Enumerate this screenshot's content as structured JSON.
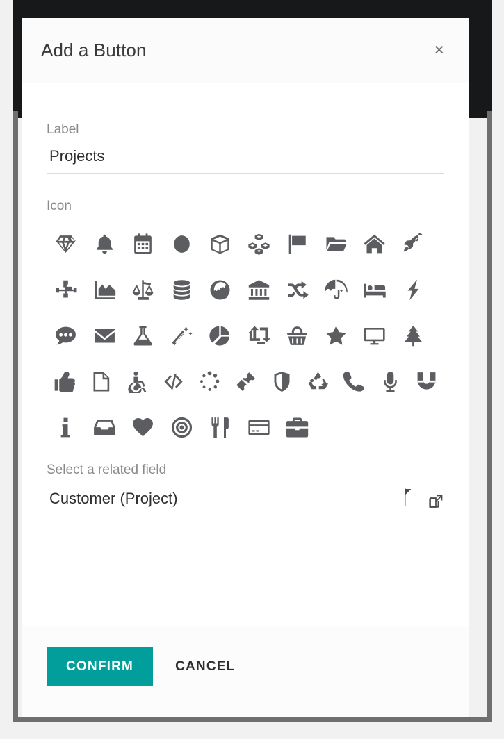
{
  "dialog": {
    "title": "Add a Button",
    "close_label": "×"
  },
  "fields": {
    "label_caption": "Label",
    "label_value": "Projects",
    "icon_caption": "Icon",
    "related_caption": "Select a related field",
    "related_value": "Customer (Project)"
  },
  "footer": {
    "confirm_label": "CONFIRM",
    "cancel_label": "CANCEL"
  },
  "colors": {
    "accent": "#019e9b",
    "icon": "#5b5d60",
    "muted_text": "#8a8a8a",
    "body_text": "#2e2e2e"
  },
  "icon_rows": [
    [
      "diamond-icon",
      "bell-icon",
      "calendar-icon",
      "circle-icon",
      "cube-icon",
      "cubes-icon",
      "flag-icon",
      "folder-open-icon",
      "home-icon",
      "rocket-icon"
    ],
    [
      "sitemap-icon",
      "area-chart-icon",
      "balance-scale-icon",
      "database-icon",
      "globe-icon",
      "bank-icon",
      "shuffle-icon",
      "umbrella-icon",
      "bed-icon",
      "bolt-icon"
    ],
    [
      "comment-icon",
      "envelope-icon",
      "flask-icon",
      "magic-wand-icon",
      "pie-chart-icon",
      "retweet-icon",
      "basket-icon",
      "star-icon",
      "desktop-icon",
      "tree-icon"
    ],
    [
      "thumbs-up-icon",
      "file-icon",
      "wheelchair-icon",
      "code-icon",
      "spinner-icon",
      "ticket-icon",
      "shield-icon",
      "recycle-icon",
      "phone-icon",
      "microphone-icon",
      "magnet-icon"
    ],
    [
      "info-icon",
      "inbox-icon",
      "heart-icon",
      "bullseye-icon",
      "cutlery-icon",
      "credit-card-icon",
      "briefcase-icon"
    ]
  ]
}
